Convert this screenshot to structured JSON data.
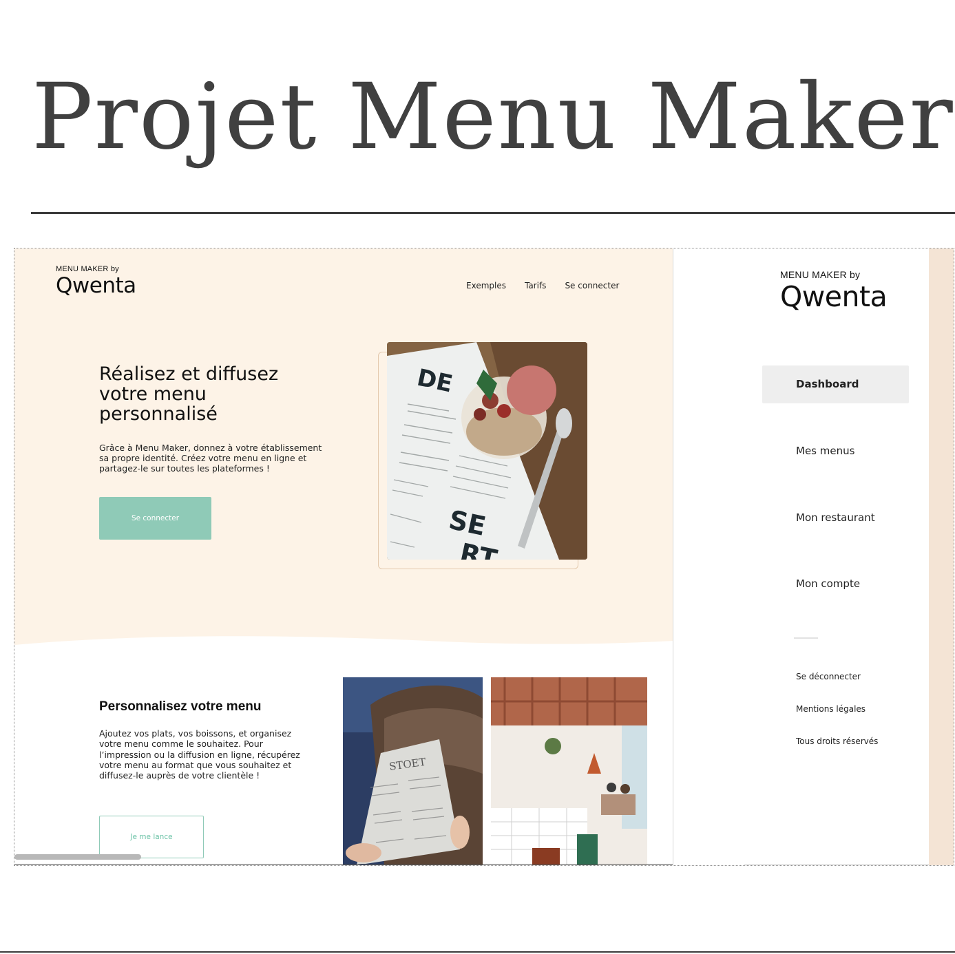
{
  "page": {
    "title": "Projet Menu Maker"
  },
  "landing": {
    "brand": {
      "small": "MENU MAKER by",
      "logo": "Qwenta"
    },
    "nav": [
      "Exemples",
      "Tarifs",
      "Se connecter"
    ],
    "hero": {
      "heading": "Réalisez et diffusez votre menu personnalisé",
      "text": "Grâce à Menu Maker, donnez à votre établissement sa propre identité. Créez votre menu en ligne et partagez-le sur toutes les plateformes !",
      "button": "Se connecter",
      "photo_text_top": "DE",
      "photo_text_bottom": "SE",
      "photo_text_bottom2": "RT"
    },
    "section2": {
      "heading": "Personnalisez votre menu",
      "text": "Ajoutez vos plats, vos boissons, et organisez votre menu comme le souhaitez. Pour l’impression ou la diffusion en ligne, récupérez votre menu au format que vous souhaitez et diffusez-le auprès de votre clientèle !",
      "button": "Je me lance",
      "photo_menu_text": "STOET"
    }
  },
  "sidemenu": {
    "brand": {
      "small": "MENU MAKER by",
      "logo": "Qwenta"
    },
    "items": [
      "Dashboard",
      "Mes menus",
      "Mon restaurant",
      "Mon compte"
    ],
    "active_index": 0,
    "footer": [
      "Se déconnecter",
      "Mentions légales",
      "Tous droits réservés"
    ]
  },
  "colors": {
    "hero_bg": "#fdf3e7",
    "accent_green": "#8fcab7",
    "active_item_bg": "#eeeeee",
    "title_gray": "#404040",
    "peach_strip": "#f4e4d5"
  }
}
